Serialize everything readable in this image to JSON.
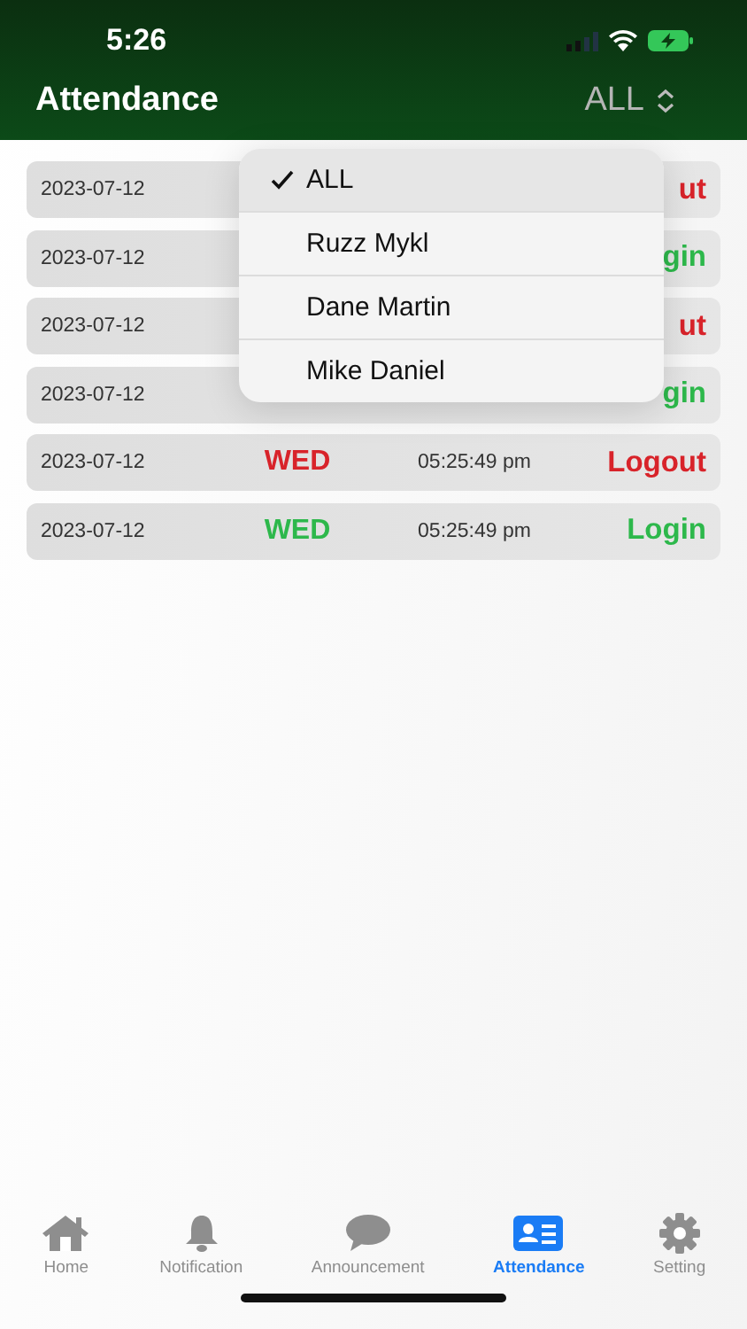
{
  "status_bar": {
    "time": "5:26"
  },
  "header": {
    "title": "Attendance",
    "filter": "ALL"
  },
  "rows": [
    {
      "date": "2023-07-12",
      "status": "ut",
      "kind": "logout"
    },
    {
      "date": "2023-07-12",
      "status": "gin",
      "kind": "login"
    },
    {
      "date": "2023-07-12",
      "status": "ut",
      "kind": "logout"
    },
    {
      "date": "2023-07-12",
      "status": "gin",
      "kind": "login"
    },
    {
      "date": "2023-07-12",
      "day": "WED",
      "time": "05:25:49 pm",
      "status": "Logout",
      "kind": "logout"
    },
    {
      "date": "2023-07-12",
      "day": "WED",
      "time": "05:25:49 pm",
      "status": "Login",
      "kind": "login"
    }
  ],
  "menu": [
    {
      "label": "ALL",
      "selected": true
    },
    {
      "label": "Ruzz Mykl",
      "selected": false
    },
    {
      "label": "Dane Martin",
      "selected": false
    },
    {
      "label": "Mike Daniel",
      "selected": false
    }
  ],
  "tabs": [
    {
      "label": "Home",
      "kind": "home",
      "selected": false
    },
    {
      "label": "Notification",
      "kind": "bell",
      "selected": false
    },
    {
      "label": "Announcement",
      "kind": "chat",
      "selected": false
    },
    {
      "label": "Attendance",
      "kind": "card",
      "selected": true
    },
    {
      "label": "Setting",
      "kind": "gear",
      "selected": false
    }
  ]
}
